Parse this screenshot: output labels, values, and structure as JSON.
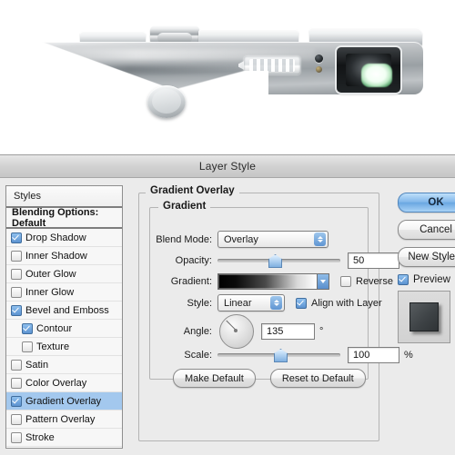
{
  "photo": {
    "subject": "silver-digital-camera-top-view",
    "parts": [
      "mode-dial",
      "shutter-deck",
      "viewfinder-window",
      "sensor-led",
      "lens-assembly",
      "round-button"
    ]
  },
  "dialog": {
    "title": "Layer Style",
    "styles_panel": {
      "header": "Styles",
      "blending_options": "Blending Options: Default",
      "items": [
        {
          "label": "Drop Shadow",
          "checked": true,
          "indent": false,
          "selected": false
        },
        {
          "label": "Inner Shadow",
          "checked": false,
          "indent": false,
          "selected": false
        },
        {
          "label": "Outer Glow",
          "checked": false,
          "indent": false,
          "selected": false
        },
        {
          "label": "Inner Glow",
          "checked": false,
          "indent": false,
          "selected": false
        },
        {
          "label": "Bevel and Emboss",
          "checked": true,
          "indent": false,
          "selected": false
        },
        {
          "label": "Contour",
          "checked": true,
          "indent": true,
          "selected": false
        },
        {
          "label": "Texture",
          "checked": false,
          "indent": true,
          "selected": false
        },
        {
          "label": "Satin",
          "checked": false,
          "indent": false,
          "selected": false
        },
        {
          "label": "Color Overlay",
          "checked": false,
          "indent": false,
          "selected": false
        },
        {
          "label": "Gradient Overlay",
          "checked": true,
          "indent": false,
          "selected": true
        },
        {
          "label": "Pattern Overlay",
          "checked": false,
          "indent": false,
          "selected": false
        },
        {
          "label": "Stroke",
          "checked": false,
          "indent": false,
          "selected": false
        }
      ]
    },
    "panel": {
      "group_title": "Gradient Overlay",
      "subgroup_title": "Gradient",
      "blend_mode": {
        "label": "Blend Mode:",
        "value": "Overlay"
      },
      "opacity": {
        "label": "Opacity:",
        "value": "50",
        "unit": "%",
        "percent": 50
      },
      "gradient": {
        "label": "Gradient:",
        "from": "#000000",
        "to": "#ffffff"
      },
      "reverse": {
        "label": "Reverse",
        "checked": false
      },
      "style": {
        "label": "Style:",
        "value": "Linear"
      },
      "align_with_layer": {
        "label": "Align with Layer",
        "checked": true
      },
      "angle": {
        "label": "Angle:",
        "value": "135",
        "unit": "°",
        "degrees": 135
      },
      "scale": {
        "label": "Scale:",
        "value": "100",
        "unit": "%",
        "percent": 100
      },
      "make_default": "Make Default",
      "reset_to_default": "Reset to Default"
    },
    "side": {
      "ok": "OK",
      "cancel": "Cancel",
      "new_style": "New Style...",
      "preview": {
        "label": "Preview",
        "checked": true
      }
    }
  },
  "colors": {
    "accent": "#5d93d0",
    "selection": "#a3c8ee",
    "dialog_bg": "#ebebeb",
    "titlebar": "#d2d2d2"
  }
}
